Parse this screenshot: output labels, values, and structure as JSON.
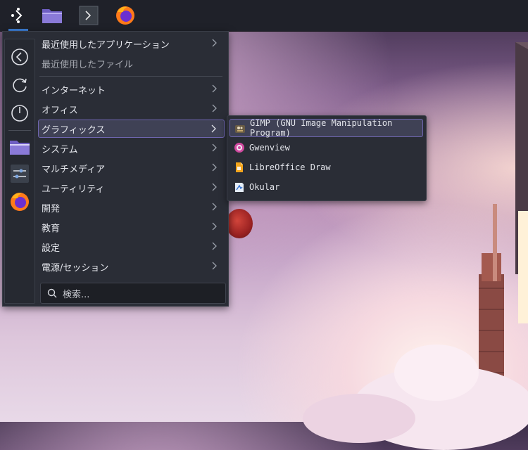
{
  "menu": {
    "items": [
      {
        "label": "最近使用したアプリケーション"
      },
      {
        "label": "最近使用したファイル"
      },
      {
        "label": "インターネット"
      },
      {
        "label": "オフィス"
      },
      {
        "label": "グラフィックス"
      },
      {
        "label": "システム"
      },
      {
        "label": "マルチメディア"
      },
      {
        "label": "ユーティリティ"
      },
      {
        "label": "開発"
      },
      {
        "label": "教育"
      },
      {
        "label": "設定"
      },
      {
        "label": "電源/セッション"
      }
    ],
    "search_placeholder": "検索..."
  },
  "submenu": {
    "items": [
      {
        "label": "GIMP (GNU Image Manipulation Program)",
        "icon": "gimp-icon"
      },
      {
        "label": "Gwenview",
        "icon": "gwenview-icon"
      },
      {
        "label": "LibreOffice Draw",
        "icon": "libreoffice-draw-icon"
      },
      {
        "label": "Okular",
        "icon": "okular-icon"
      }
    ]
  },
  "colors": {
    "panel": "#1f2129",
    "menu_bg": "#2a2d36",
    "highlight": "#3f4155",
    "highlight_border": "#6f66b0"
  }
}
